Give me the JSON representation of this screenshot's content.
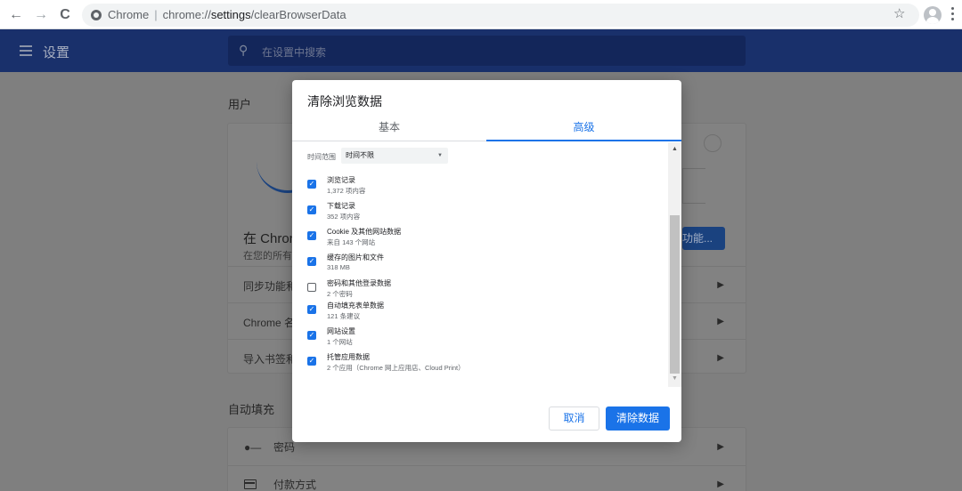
{
  "browser": {
    "back": "←",
    "forward": "→",
    "reload": "C",
    "site_label": "Chrome",
    "url_prefix": "chrome://",
    "url_host": "settings",
    "url_path": "/clearBrowserData",
    "star": "☆"
  },
  "settings": {
    "title": "设置",
    "search_placeholder": "在设置中搜索",
    "section_people": "用户",
    "chrome_heading": "在 Chron",
    "chrome_sub": "在您的所有",
    "sync_button": "功能...",
    "rows": [
      "同步功能和",
      "Chrome 名",
      "导入书签和"
    ],
    "section_autofill": "自动填充",
    "autofill_rows": [
      "密码",
      "付款方式"
    ]
  },
  "dialog": {
    "title": "清除浏览数据",
    "tabs": [
      "基本",
      "高级"
    ],
    "time_range_label": "时间范围",
    "time_range_value": "时间不限",
    "items": [
      {
        "label": "浏览记录",
        "sub": "1,372 项内容",
        "checked": true
      },
      {
        "label": "下载记录",
        "sub": "352 项内容",
        "checked": true
      },
      {
        "label": "Cookie 及其他网站数据",
        "sub": "来自 143 个网站",
        "checked": true
      },
      {
        "label": "缓存的图片和文件",
        "sub": "318 MB",
        "checked": true
      },
      {
        "label": "密码和其他登录数据",
        "sub": "2 个密码",
        "checked": false
      },
      {
        "label": "自动填充表单数据",
        "sub": "121 条建议",
        "checked": true
      },
      {
        "label": "网站设置",
        "sub": "1 个网站",
        "checked": true
      },
      {
        "label": "托管应用数据",
        "sub": "2 个应用（Chrome 网上应用店、Cloud Print）",
        "checked": true
      }
    ],
    "cancel": "取消",
    "confirm": "清除数据"
  }
}
